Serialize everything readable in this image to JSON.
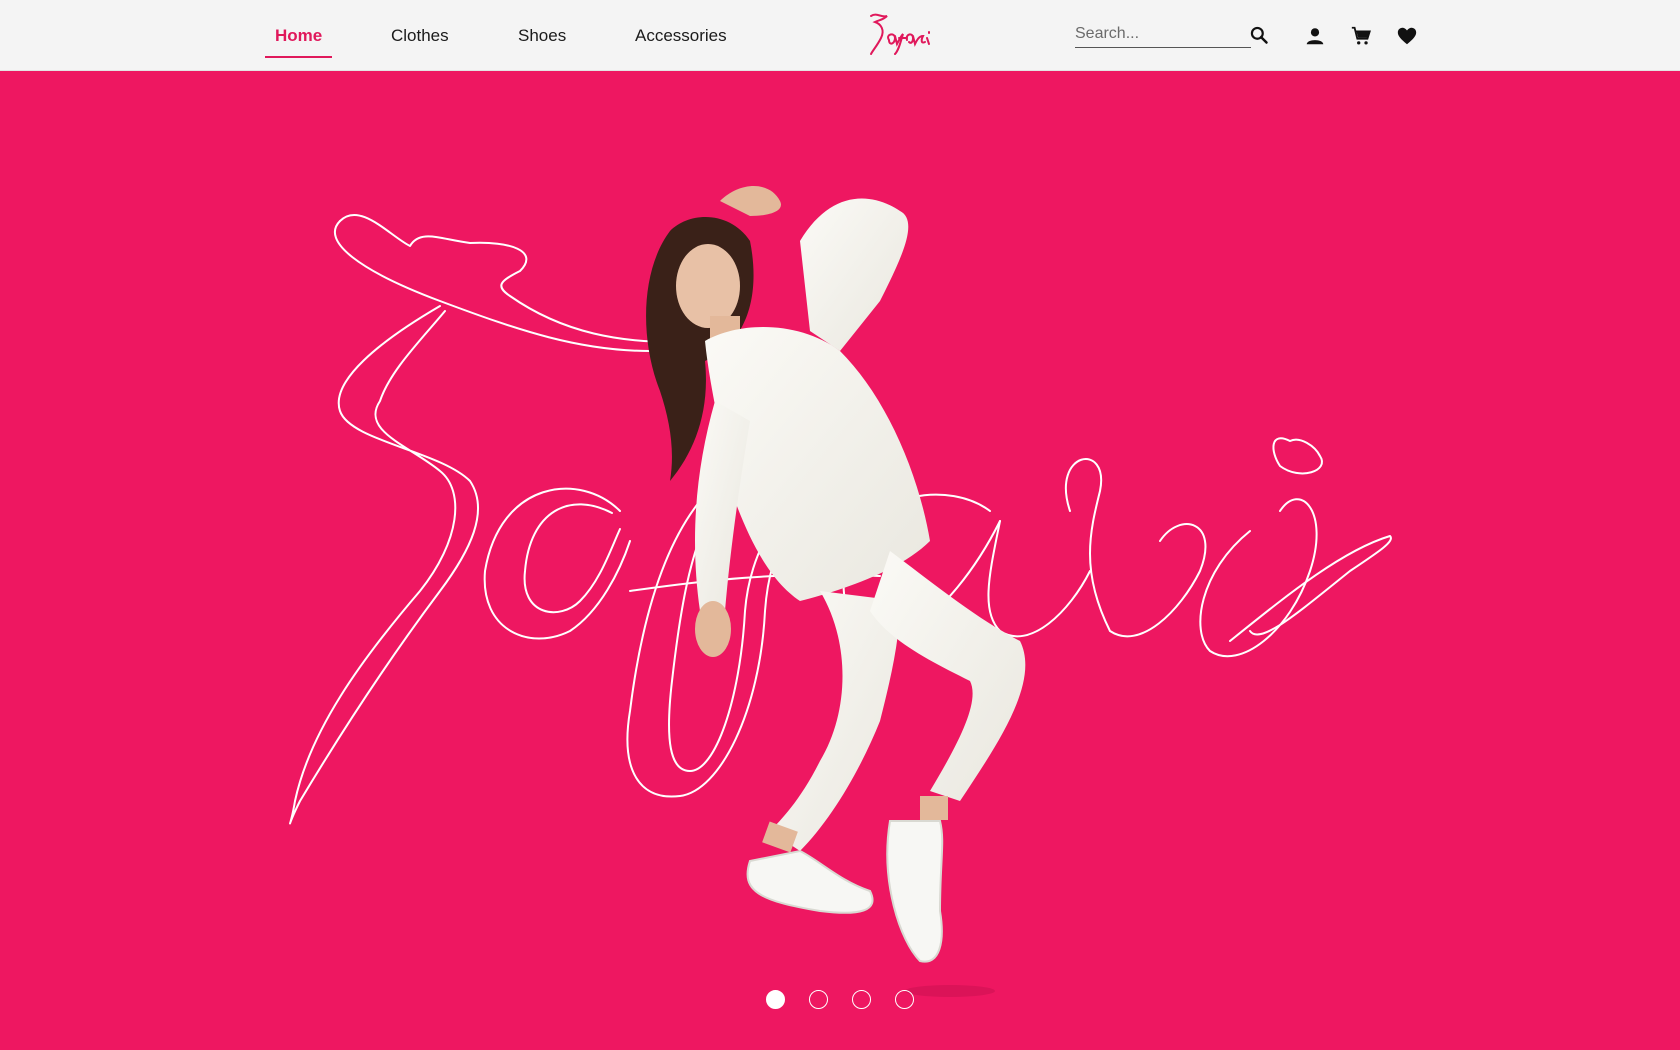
{
  "nav": {
    "items": [
      {
        "label": "Home",
        "active": true
      },
      {
        "label": "Clothes",
        "active": false
      },
      {
        "label": "Shoes",
        "active": false
      },
      {
        "label": "Accessories",
        "active": false
      }
    ]
  },
  "brand": {
    "logo_text": "Safari",
    "accent_color": "#e0185b"
  },
  "search": {
    "placeholder": "Search..."
  },
  "header_icons": [
    "search-icon",
    "user-icon",
    "cart-icon",
    "heart-icon"
  ],
  "hero": {
    "background_color": "#ee1761",
    "script_text": "Safari",
    "slides": {
      "count": 4,
      "active_index": 0
    }
  }
}
